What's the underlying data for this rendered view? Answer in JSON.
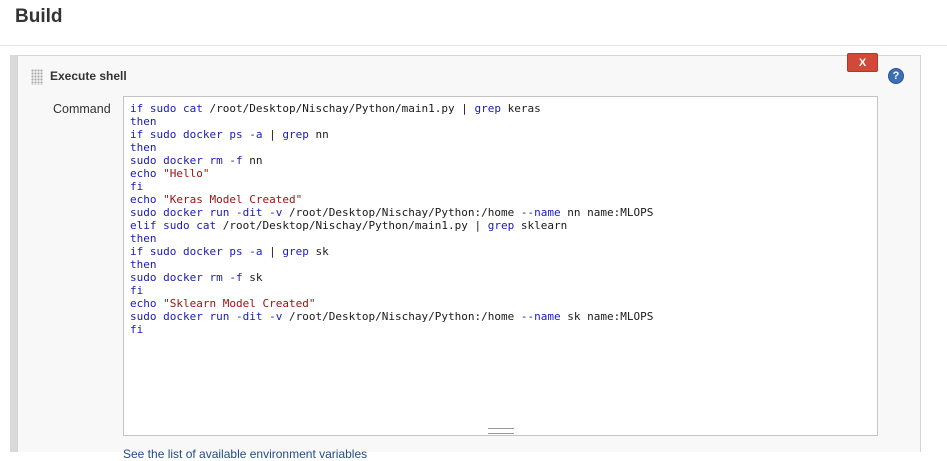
{
  "section": {
    "title": "Build"
  },
  "step": {
    "title": "Execute shell",
    "delete_label": "X",
    "help_glyph": "?",
    "command_label": "Command",
    "drag_icon": "grip-dots-icon",
    "help_icon": "question-circle-icon"
  },
  "command": {
    "lines": [
      "if sudo cat /root/Desktop/Nischay/Python/main1.py | grep keras",
      "then",
      "if sudo docker ps -a | grep nn",
      "then",
      "sudo docker rm -f nn",
      "echo \"Hello\"",
      "fi",
      "echo \"Keras Model Created\"",
      "sudo docker run -dit -v /root/Desktop/Nischay/Python:/home --name nn name:MLOPS",
      "elif sudo cat /root/Desktop/Nischay/Python/main1.py | grep sklearn",
      "then",
      "if sudo docker ps -a | grep sk",
      "then",
      "sudo docker rm -f sk",
      "fi",
      "echo \"Sklearn Model Created\"",
      "sudo docker run -dit -v /root/Desktop/Nischay/Python:/home --name sk name:MLOPS",
      "fi"
    ]
  },
  "footer": {
    "env_link": "See the list of available environment variables"
  },
  "colors": {
    "keyword": "#1a1ab6",
    "string": "#a11111",
    "delete_button": "#d24939",
    "help_icon": "#3d6fb5",
    "link": "#204a87"
  }
}
